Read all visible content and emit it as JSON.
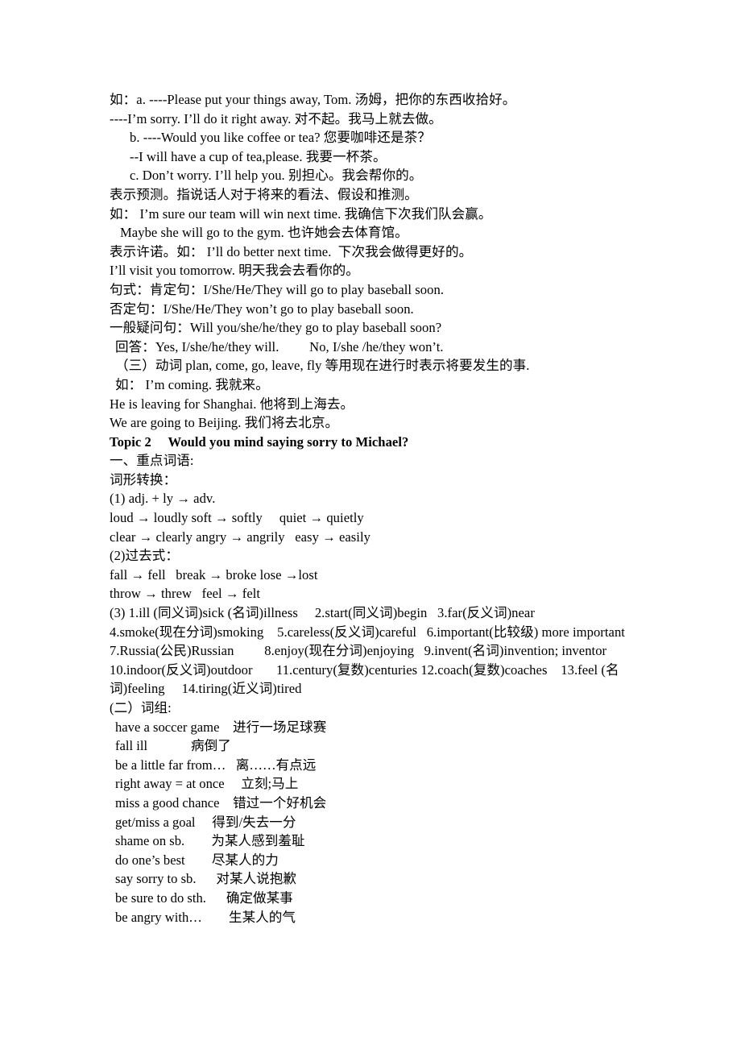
{
  "document": {
    "section_future_examples": [
      {
        "id": "l1",
        "indent": 0,
        "text": "如：a. ----Please put your things away, Tom. 汤姆，把你的东西收拾好。"
      },
      {
        "id": "l2",
        "indent": 0,
        "text": "----I’m sorry. I’ll do it right away. 对不起。我马上就去做。"
      },
      {
        "id": "l3",
        "indent": 2,
        "text": "b. ----Would you like coffee or tea? 您要咖啡还是茶？"
      },
      {
        "id": "l4",
        "indent": 2,
        "text": "--I will have a cup of tea,please. 我要一杯茶。"
      },
      {
        "id": "l5",
        "indent": 2,
        "text": "c. Don’t worry. I’ll help you. 别担心。我会帮你的。"
      },
      {
        "id": "l6",
        "indent": 0,
        "text": "表示预测。指说话人对于将来的看法、假设和推测。"
      },
      {
        "id": "l7",
        "indent": 0,
        "text": "如： I’m sure our team will win next time. 我确信下次我们队会赢。"
      },
      {
        "id": "l8",
        "indent": 1,
        "text": "Maybe she will go to the gym. 也许她会去体育馆。"
      },
      {
        "id": "l9",
        "indent": 0,
        "text": "表示许诺。如： I’ll do better next time.  下次我会做得更好的。"
      },
      {
        "id": "l10",
        "indent": 0,
        "text": "I’ll visit you tomorrow. 明天我会去看你的。"
      },
      {
        "id": "l11",
        "indent": 0,
        "text": "句式：肯定句：I/She/He/They will go to play baseball soon."
      },
      {
        "id": "l12",
        "indent": 0,
        "text": "否定句：I/She/He/They won’t go to play baseball soon."
      },
      {
        "id": "l13",
        "indent": 0,
        "text": "一般疑问句：Will you/she/he/they go to play baseball soon?"
      },
      {
        "id": "l14",
        "indent": 3,
        "text": "回答：Yes, I/she/he/they will.         No, I/she /he/they won’t."
      },
      {
        "id": "l15",
        "indent": 3,
        "text": "（三）动词 plan, come, go, leave, fly 等用现在进行时表示将要发生的事."
      },
      {
        "id": "l16",
        "indent": 3,
        "text": "如： I’m coming. 我就来。"
      },
      {
        "id": "l17",
        "indent": 0,
        "text": "He is leaving for Shanghai. 他将到上海去。"
      },
      {
        "id": "l18",
        "indent": 0,
        "text": "We are going to Beijing. 我们将去北京。"
      }
    ],
    "topic_heading": "Topic 2     Would you mind saying sorry to Michael?",
    "section_key_words": [
      {
        "id": "k1",
        "indent": 0,
        "text": "一、重点词语:"
      },
      {
        "id": "k2",
        "indent": 0,
        "text": "词形转换："
      },
      {
        "id": "k3",
        "indent": 0,
        "text": "(1) adj. + ly → adv."
      },
      {
        "id": "k4",
        "indent": 0,
        "text": "loud → loudly soft → softly     quiet → quietly"
      },
      {
        "id": "k5",
        "indent": 0,
        "text": "clear → clearly angry → angrily   easy → easily"
      },
      {
        "id": "k6",
        "indent": 0,
        "text": "(2)过去式："
      },
      {
        "id": "k7",
        "indent": 0,
        "text": "fall → fell   break → broke lose →lost"
      },
      {
        "id": "k8",
        "indent": 0,
        "text": "throw → threw   feel → felt"
      },
      {
        "id": "k9",
        "indent": 0,
        "text": "(3) 1.ill (同义词)sick (名词)illness     2.start(同义词)begin   3.far(反义词)near"
      },
      {
        "id": "k10",
        "indent": 0,
        "text": "4.smoke(现在分词)smoking    5.careless(反义词)careful   6.important(比较级) more important"
      },
      {
        "id": "k11",
        "indent": 0,
        "text": "7.Russia(公民)Russian         8.enjoy(现在分词)enjoying   9.invent(名词)invention; inventor"
      },
      {
        "id": "k12",
        "indent": 0,
        "text": "10.indoor(反义词)outdoor       11.century(复数)centuries 12.coach(复数)coaches    13.feel (名"
      },
      {
        "id": "k13",
        "indent": 0,
        "text": "词)feeling     14.tiring(近义词)tired"
      },
      {
        "id": "k14",
        "indent": 0,
        "text": "(二）词组:"
      }
    ],
    "phrases_heading": "(二）词组:",
    "phrases": [
      {
        "en": "have a soccer game",
        "gap": "    ",
        "zh": "进行一场足球赛"
      },
      {
        "en": "fall ill",
        "gap": "             ",
        "zh": "病倒了"
      },
      {
        "en": "be a little far from…",
        "gap": "   ",
        "zh": "离……有点远"
      },
      {
        "en": "right away = at once",
        "gap": "     ",
        "zh": "立刻;马上"
      },
      {
        "en": "miss a good chance",
        "gap": "    ",
        "zh": "错过一个好机会"
      },
      {
        "en": "get/miss a goal",
        "gap": "     ",
        "zh": "得到/失去一分"
      },
      {
        "en": "shame on sb.",
        "gap": "        ",
        "zh": "为某人感到羞耻"
      },
      {
        "en": "do one’s best",
        "gap": "        ",
        "zh": "尽某人的力"
      },
      {
        "en": "say sorry to sb.",
        "gap": "      ",
        "zh": "对某人说抱歉"
      },
      {
        "en": "be sure to do sth.",
        "gap": "      ",
        "zh": "确定做某事"
      },
      {
        "en": "be angry with…",
        "gap": "        ",
        "zh": "生某人的气"
      }
    ]
  }
}
